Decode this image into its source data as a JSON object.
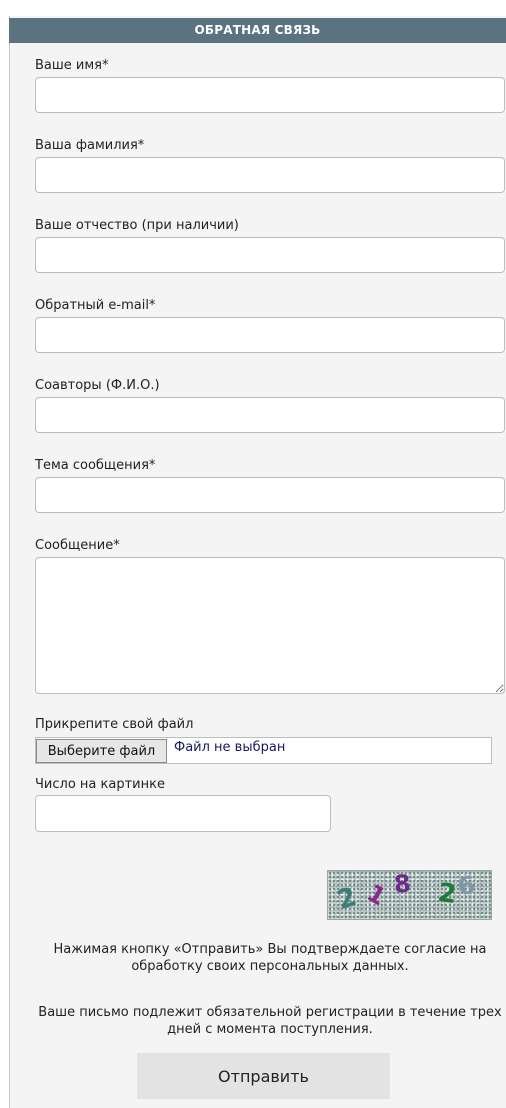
{
  "form": {
    "title": "ОБРАТНАЯ СВЯЗЬ",
    "fields": {
      "first_name": {
        "label": "Ваше имя*",
        "value": ""
      },
      "last_name": {
        "label": "Ваша фамилия*",
        "value": ""
      },
      "patronymic": {
        "label": "Ваше отчество (при наличии)",
        "value": ""
      },
      "email": {
        "label": "Обратный e-mail*",
        "value": ""
      },
      "coauthors": {
        "label": "Соавторы (Ф.И.О.)",
        "value": ""
      },
      "subject": {
        "label": "Тема сообщения*",
        "value": ""
      },
      "message": {
        "label": "Сообщение*",
        "value": ""
      }
    },
    "file": {
      "label": "Прикрепите свой файл",
      "button_label": "Выберите файл",
      "status": "Файл не выбран"
    },
    "captcha": {
      "label": "Число на картинке",
      "value": "",
      "digits": [
        "2",
        "1",
        "8",
        "2",
        "6"
      ],
      "digit_colors": [
        "#3c7d7a",
        "#8a2a8e",
        "#6b2a8e",
        "#1f7a3a",
        "#7f95a8"
      ]
    },
    "consent_text": "Нажимая кнопку «Отправить» Вы подтверждаете согласие на обработку своих персональных данных.",
    "registration_text": "Ваше письмо подлежит обязательной регистрации в течение трех дней с момента поступления.",
    "submit_label": "Отправить"
  }
}
